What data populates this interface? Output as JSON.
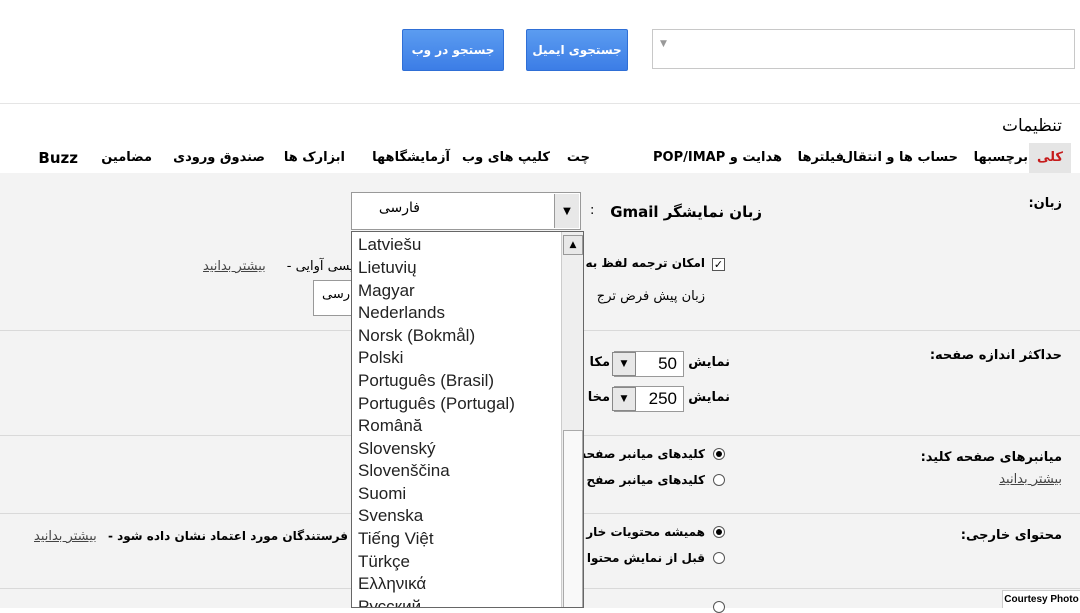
{
  "header": {
    "search_mail_label": "جستجوی ایمیل",
    "search_web_label": "جستجو در وب",
    "search_value": ""
  },
  "settings_title": "تنظیمات",
  "tabs": [
    {
      "label": "کلی",
      "active": true
    },
    {
      "label": "برچسبها"
    },
    {
      "label": "حساب ها و انتقال"
    },
    {
      "label": "فیلترها"
    },
    {
      "label": "هدایت و POP/IMAP"
    },
    {
      "label": "چت"
    },
    {
      "label": "کلیپ های وب"
    },
    {
      "label": "آزمایشگاهها"
    },
    {
      "label": "ابزارک ها"
    },
    {
      "label": "صندوق ورودی"
    },
    {
      "label": "مضامین"
    },
    {
      "label": "Buzz"
    }
  ],
  "language": {
    "label": "زبان:",
    "display_label": "زبان نمایشگر Gmail",
    "colon": ":",
    "selected": "فارسی",
    "options": [
      "Latviešu",
      "Lietuvių",
      "Magyar",
      "Nederlands",
      "Norsk (Bokmål)",
      "Polski",
      "Português (Brasil)",
      "Português (Portugal)",
      "Română",
      "Slovenský",
      "Slovenščina",
      "Suomi",
      "Svenska",
      "Tiếng Việt",
      "Türkçe",
      "Ελληνικά",
      "Русский"
    ],
    "translit_label": "امکان ترجمه لفظ به",
    "translit_checked": true,
    "translit_suffix": "لیسی آوایی -",
    "learn_more": "بیشتر بدانید",
    "default_translit_label": "زبان پیش فرض ترج",
    "default_translit_value": "رسی"
  },
  "page_size": {
    "label": "حداکثر اندازه صفحه:",
    "show_label": "نمایش",
    "conversations_value": "50",
    "conversations_suffix": "مکا",
    "contacts_value": "250",
    "contacts_suffix": "مخا"
  },
  "shortcuts": {
    "label": "میانبرهای صفحه کلید:",
    "learn_more": "بیشتر بدانید",
    "option_on": "کلیدهای میانبر صفحه",
    "option_off": "کلیدهای میانبر صفح",
    "selected": "on"
  },
  "external_content": {
    "label": "محتوای خارجی:",
    "option_always": "همیشه محتویات خار",
    "option_ask": "قبل از نمایش محتوا",
    "trusted_text": "فرستندگان مورد اعتماد نشان داده شود -",
    "learn_more": "بیشتر بدانید",
    "selected": "always"
  },
  "footer": {
    "courtesy": "Courtesy Photo"
  }
}
